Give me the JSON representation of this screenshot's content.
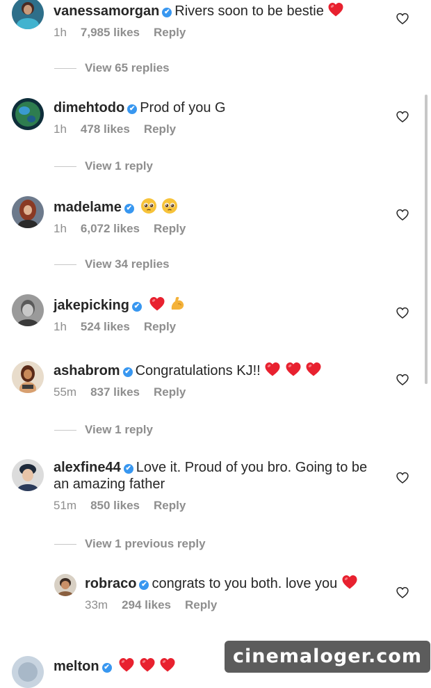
{
  "icons": {
    "verified": "✔",
    "like": "heart-outline-icon",
    "heart": "red-heart-emoji",
    "pleading": "pleading-face-emoji",
    "muscle": "flexed-biceps-emoji"
  },
  "colors": {
    "verified": "#3897f0",
    "heart": "#e8212f",
    "meta": "#8e8e8e",
    "text": "#262626"
  },
  "comments": [
    {
      "username": "vanessamorgan",
      "text": "Rivers soon to be bestie",
      "time": "1h",
      "likes": "7,985 likes",
      "reply": "Reply"
    },
    {
      "username": "dimehtodo",
      "text": "Prod of you G",
      "time": "1h",
      "likes": "478 likes",
      "reply": "Reply"
    },
    {
      "username": "madelame",
      "text": "",
      "time": "1h",
      "likes": "6,072 likes",
      "reply": "Reply"
    },
    {
      "username": "jakepicking",
      "text": "",
      "time": "1h",
      "likes": "524 likes",
      "reply": "Reply"
    },
    {
      "username": "ashabrom",
      "text": "Congratulations KJ!!",
      "time": "55m",
      "likes": "837 likes",
      "reply": "Reply"
    },
    {
      "username": "alexfine44",
      "text": "Love it. Proud of you bro. Going to be an amazing father",
      "time": "51m",
      "likes": "850 likes",
      "reply": "Reply"
    },
    {
      "username": "robraco",
      "text": "congrats to you both. love you",
      "time": "33m",
      "likes": "294 likes",
      "reply": "Reply"
    },
    {
      "username": "melton",
      "text": ""
    }
  ],
  "view_links": [
    "View 65 replies",
    "View 1 reply",
    "View 34 replies",
    "View 1 reply",
    "View 1 previous reply"
  ],
  "watermark": "cinemaloger.com"
}
